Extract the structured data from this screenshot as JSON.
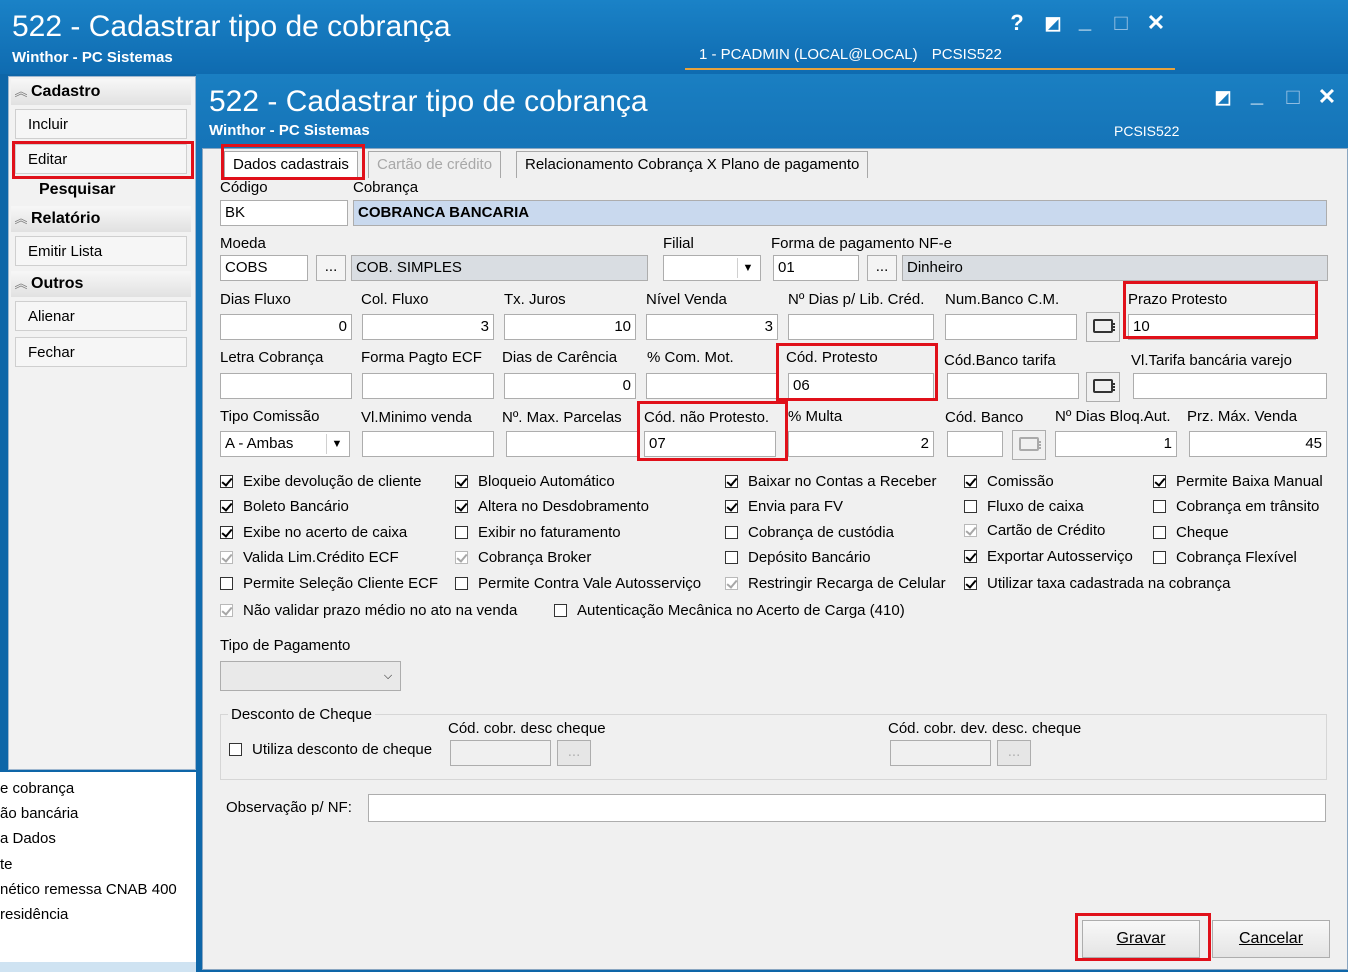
{
  "outer": {
    "title": "522 - Cadastrar tipo de cobrança",
    "subtitle": "Winthor - PC Sistemas",
    "user_info": "1 - PCADMIN (LOCAL@LOCAL)",
    "program": "PCSIS522",
    "buttons": {
      "help": "?",
      "restore": "◩",
      "minimize": "_",
      "maximize": "□",
      "close": "✕"
    }
  },
  "sidebar": {
    "sections": [
      {
        "label": "Cadastro",
        "items": [
          "Incluir",
          "Editar",
          "Pesquisar"
        ]
      },
      {
        "label": "Relatório",
        "items": [
          "Emitir Lista"
        ]
      },
      {
        "label": "Outros",
        "items": [
          "Alienar",
          "Fechar"
        ]
      }
    ],
    "list_lines": [
      "e cobrança",
      "ão bancária",
      "a Dados",
      "te",
      "nético remessa CNAB 400",
      "residência"
    ]
  },
  "inner": {
    "title": "522 - Cadastrar tipo de cobrança",
    "subtitle": "Winthor - PC Sistemas",
    "program": "PCSIS522",
    "buttons": {
      "restore": "◩",
      "minimize": "_",
      "maximize": "□",
      "close": "✕"
    }
  },
  "tabs": [
    "Dados cadastrais",
    "Cartão de crédito",
    "Relacionamento Cobrança X Plano de pagamento"
  ],
  "form": {
    "labels": {
      "codigo": "Código",
      "cobranca": "Cobrança",
      "moeda": "Moeda",
      "filial": "Filial",
      "forma_pagto": "Forma de pagamento NF-e",
      "dias_fluxo": "Dias Fluxo",
      "col_fluxo": "Col. Fluxo",
      "tx_juros": "Tx. Juros",
      "nivel_venda": "Nível Venda",
      "dias_lib": "Nº Dias p/ Lib. Créd.",
      "num_banco": "Num.Banco C.M.",
      "prazo_protesto": "Prazo Protesto",
      "letra_cobranca": "Letra Cobrança",
      "forma_pagto_ecf": "Forma Pagto ECF",
      "dias_carencia": "Dias de Carência",
      "com_mot": "% Com. Mot.",
      "cod_protesto": "Cód. Protesto",
      "cod_banco_tarifa": "Cód.Banco tarifa",
      "vl_tarifa": "Vl.Tarifa bancária varejo",
      "tipo_comissao": "Tipo Comissão",
      "vl_minimo": "Vl.Minimo venda",
      "max_parcelas": "Nº. Max. Parcelas",
      "cod_nao_protesto": "Cód. não Protesto.",
      "multa": "% Multa",
      "cod_banco": "Cód. Banco",
      "dias_bloq": "Nº Dias Bloq.Aut.",
      "prz_max_venda": "Prz. Máx. Venda"
    },
    "values": {
      "codigo": "BK",
      "cobranca": "COBRANCA BANCARIA",
      "moeda": "COBS",
      "moeda_desc": "COB. SIMPLES",
      "filial": "",
      "forma_pagto": "01",
      "forma_pagto_desc": "Dinheiro",
      "dias_fluxo": "0",
      "col_fluxo": "3",
      "tx_juros": "10",
      "nivel_venda": "3",
      "dias_lib": "",
      "num_banco": "",
      "prazo_protesto": "10",
      "letra_cobranca": "",
      "forma_pagto_ecf": "",
      "dias_carencia": "0",
      "com_mot": "",
      "cod_protesto": "06",
      "cod_banco_tarifa": "",
      "vl_tarifa": "",
      "tipo_comissao": "A - Ambas",
      "vl_minimo": "",
      "max_parcelas": "",
      "cod_nao_protesto": "07",
      "multa": "2",
      "cod_banco": "",
      "dias_bloq": "1",
      "prz_max_venda": "45"
    },
    "dots": "...",
    "checkboxes": [
      {
        "label": "Exibe devolução de cliente",
        "checked": true,
        "disabled": false
      },
      {
        "label": "Bloqueio Automático",
        "checked": true,
        "disabled": false
      },
      {
        "label": "Baixar no Contas a Receber",
        "checked": true,
        "disabled": false
      },
      {
        "label": "Comissão",
        "checked": true,
        "disabled": false
      },
      {
        "label": "Permite Baixa Manual",
        "checked": true,
        "disabled": false
      },
      {
        "label": "Boleto Bancário",
        "checked": true,
        "disabled": false
      },
      {
        "label": "Altera no Desdobramento",
        "checked": true,
        "disabled": false
      },
      {
        "label": "Envia para FV",
        "checked": true,
        "disabled": false
      },
      {
        "label": "Fluxo de caixa",
        "checked": false,
        "disabled": false
      },
      {
        "label": "Cobrança em trânsito",
        "checked": false,
        "disabled": false
      },
      {
        "label": "Exibe no acerto de caixa",
        "checked": true,
        "disabled": false
      },
      {
        "label": "Exibir no faturamento",
        "checked": false,
        "disabled": false
      },
      {
        "label": "Cobrança de custódia",
        "checked": false,
        "disabled": false
      },
      {
        "label": "Cartão de Crédito",
        "checked": true,
        "disabled": true
      },
      {
        "label": "Cheque",
        "checked": false,
        "disabled": false
      },
      {
        "label": "Valida Lim.Crédito ECF",
        "checked": true,
        "disabled": true
      },
      {
        "label": "Cobrança Broker",
        "checked": true,
        "disabled": true
      },
      {
        "label": "Depósito Bancário",
        "checked": false,
        "disabled": false
      },
      {
        "label": "Exportar Autosserviço",
        "checked": true,
        "disabled": false
      },
      {
        "label": "Cobrança Flexível",
        "checked": false,
        "disabled": false
      },
      {
        "label": "Permite Seleção Cliente ECF",
        "checked": false,
        "disabled": false
      },
      {
        "label": "Permite Contra Vale Autosserviço",
        "checked": false,
        "disabled": false
      },
      {
        "label": "Restringir Recarga de Celular",
        "checked": true,
        "disabled": true
      },
      {
        "label": "Utilizar taxa cadastrada na cobrança",
        "checked": true,
        "disabled": false
      },
      {
        "label": "Não validar prazo médio no ato na venda",
        "checked": true,
        "disabled": true
      },
      {
        "label": "Autenticação Mecânica no Acerto de Carga (410)",
        "checked": false,
        "disabled": false
      }
    ],
    "tipo_pagamento_label": "Tipo de Pagamento",
    "tipo_pagamento_value": "",
    "desconto": {
      "title": "Desconto de Cheque",
      "checkbox_label": "Utiliza desconto de cheque",
      "cod_desc_label": "Cód. cobr. desc cheque",
      "cod_dev_label": "Cód. cobr. dev. desc. cheque"
    },
    "obs_label": "Observação p/ NF:",
    "obs_value": ""
  },
  "actions": {
    "save": "Gravar",
    "cancel": "Cancelar"
  },
  "colors": {
    "titlebar": "#1574b8",
    "highlight": "#e0101a",
    "field_blue": "#c9d9ee"
  }
}
